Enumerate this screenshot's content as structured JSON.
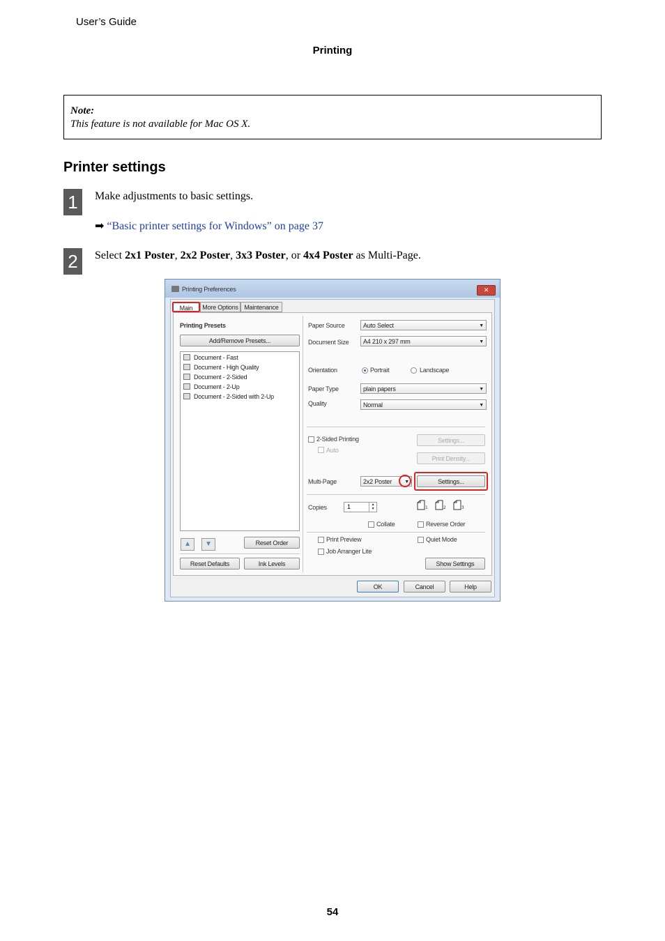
{
  "header": {
    "guide": "User’s Guide",
    "section": "Printing"
  },
  "note": {
    "title": "Note:",
    "body": "This feature is not available for Mac OS X."
  },
  "heading": "Printer settings",
  "steps": [
    {
      "number": "1",
      "text": "Make adjustments to basic settings.",
      "link": "“Basic printer settings for Windows” on page 37"
    },
    {
      "number": "2",
      "parts": [
        "Select ",
        "2x1 Poster",
        ", ",
        "2x2 Poster",
        ", ",
        "3x3 Poster",
        ", or ",
        "4x4 Poster",
        " as Multi-Page."
      ]
    }
  ],
  "dialog": {
    "title": "Printing Preferences",
    "close": "✕",
    "tabs": [
      "Main",
      "More Options",
      "Maintenance"
    ],
    "presets_label": "Printing Presets",
    "add_remove": "Add/Remove Presets...",
    "presets": [
      "Document - Fast",
      "Document - High Quality",
      "Document - 2-Sided",
      "Document - 2-Up",
      "Document - 2-Sided with 2-Up"
    ],
    "reset_order": "Reset Order",
    "reset_defaults": "Reset Defaults",
    "ink_levels": "Ink Levels",
    "paper_source_label": "Paper Source",
    "paper_source": "Auto Select",
    "document_size_label": "Document Size",
    "document_size": "A4 210 x 297 mm",
    "orientation_label": "Orientation",
    "portrait": "Portrait",
    "landscape": "Landscape",
    "paper_type_label": "Paper Type",
    "paper_type": "plain papers",
    "quality_label": "Quality",
    "quality": "Normal",
    "two_sided": "2-Sided Printing",
    "auto": "Auto",
    "settings_disabled": "Settings...",
    "print_density": "Print Density...",
    "multipage_label": "Multi-Page",
    "multipage": "2x2 Poster",
    "settings": "Settings...",
    "copies_label": "Copies",
    "copies": "1",
    "collate": "Collate",
    "reverse_order": "Reverse Order",
    "print_preview": "Print Preview",
    "quiet_mode": "Quiet Mode",
    "job_arranger": "Job Arranger Lite",
    "show_settings": "Show Settings",
    "ok": "OK",
    "cancel": "Cancel",
    "help": "Help"
  },
  "page_number": "54"
}
